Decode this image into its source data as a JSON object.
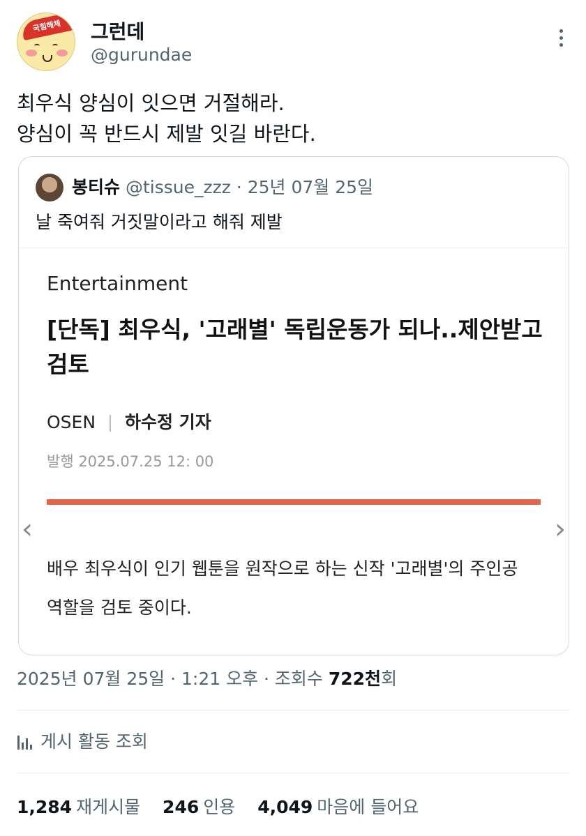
{
  "author": {
    "display_name": "그런데",
    "handle": "@gurundae",
    "avatar_text": "국힘해체"
  },
  "tweet": {
    "lines": [
      "최우식 양심이 잇으면 거절해라.",
      "양심이 꼭 반드시 제발 잇길 바란다."
    ]
  },
  "quote": {
    "name": "봉티슈",
    "handle": "@tissue_zzz",
    "separator": " · ",
    "date": "25년 07월 25일",
    "text": "날 죽여줘 거짓말이라고 해줘 제발",
    "article": {
      "section": "Entertainment",
      "headline": "[단독] 최우식, '고래별' 독립운동가 되나..제안받고 검토",
      "source": "OSEN",
      "reporter": "하수정 기자",
      "published": "발행 2025.07.25 12: 00",
      "body": "배우 최우식이 인기 웹툰을 원작으로 하는 신작 '고래별'의 주인공 역할을 검토 중이다.",
      "accent_color": "#e2644f"
    }
  },
  "meta": {
    "date": "2025년 07월 25일",
    "sep1": " · ",
    "time": "1:21 오후",
    "sep2": " · ",
    "views_label": "조회수 ",
    "views_value": "722천",
    "views_suffix": "회"
  },
  "activity": {
    "label": "게시 활동 조회",
    "icon": "bar-chart-icon"
  },
  "stats": {
    "retweets_value": "1,284",
    "retweets_label": "재게시물",
    "quotes_value": "246",
    "quotes_label": "인용",
    "likes_value": "4,049",
    "likes_label": "마음에 들어요"
  },
  "colors": {
    "text": "#0f1419",
    "secondary": "#536471",
    "border": "#cfd9de"
  }
}
